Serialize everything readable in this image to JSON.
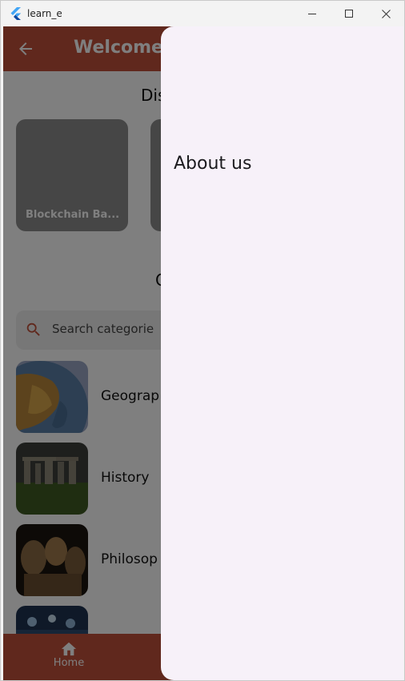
{
  "window": {
    "title": "learn_e"
  },
  "appbar": {
    "title": "Welcome",
    "back_icon": "arrow-back-icon"
  },
  "discover": {
    "title": "Dis",
    "cards": [
      {
        "label": "Blockchain Ba..."
      },
      {
        "label": ""
      }
    ]
  },
  "categories": {
    "title": "C",
    "search_placeholder": "Search categorie",
    "items": [
      {
        "label": "Geograp",
        "image": "globe"
      },
      {
        "label": "History",
        "image": "stonehenge"
      },
      {
        "label": "Philosop",
        "image": "statues"
      },
      {
        "label": "",
        "image": "lab"
      }
    ]
  },
  "bottom_nav": {
    "home_label": "Home",
    "home_icon": "home-icon"
  },
  "drawer": {
    "items": [
      "About us"
    ]
  },
  "colors": {
    "appbar": "#c0503a",
    "drawer_bg": "#f7f1f9",
    "search_icon": "#c0503a"
  }
}
